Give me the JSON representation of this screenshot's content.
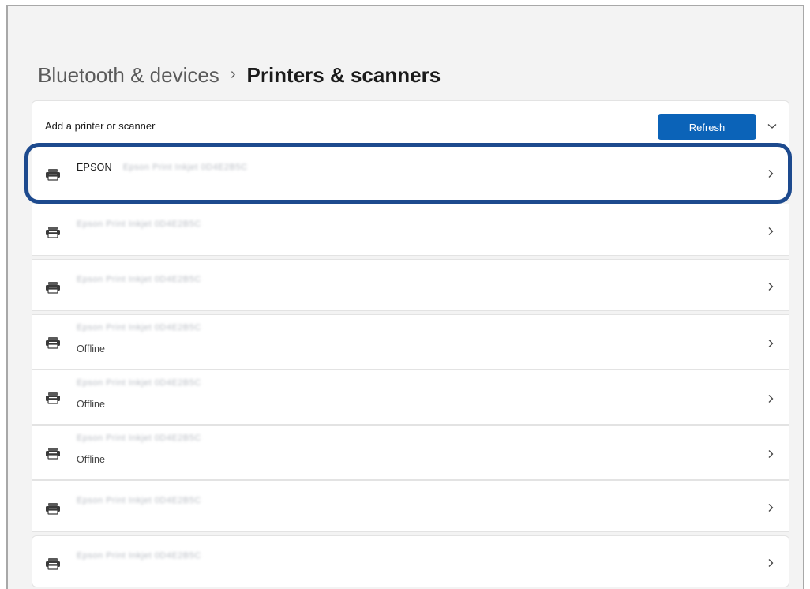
{
  "breadcrumb": {
    "parent": "Bluetooth & devices",
    "separator": "›",
    "current": "Printers & scanners"
  },
  "add_printer": {
    "label": "Add a printer or scanner",
    "refresh_label": "Refresh",
    "expand_icon": "chevron-down-icon"
  },
  "printers": [
    {
      "brand": "EPSON",
      "name": "Epson Print Inkjet 0D4E2B5C",
      "status": ""
    },
    {
      "brand": "",
      "name": "Epson Print Inkjet 0D4E2B5C",
      "status": ""
    },
    {
      "brand": "",
      "name": "Epson Print Inkjet 0D4E2B5C",
      "status": ""
    },
    {
      "brand": "",
      "name": "Epson Print Inkjet 0D4E2B5C",
      "status": "Offline"
    },
    {
      "brand": "",
      "name": "Epson Print Inkjet 0D4E2B5C",
      "status": "Offline"
    },
    {
      "brand": "",
      "name": "Epson Print Inkjet 0D4E2B5C",
      "status": "Offline"
    },
    {
      "brand": "",
      "name": "Epson Print Inkjet 0D4E2B5C",
      "status": ""
    },
    {
      "brand": "",
      "name": "Epson Print Inkjet 0D4E2B5C",
      "status": ""
    }
  ],
  "colors": {
    "accent": "#0b63b8",
    "highlight_border": "#1d4a8e",
    "background": "#f3f3f3",
    "card": "#ffffff"
  },
  "icons": {
    "printer": "printer-icon",
    "row_chevron": "chevron-right-icon"
  }
}
